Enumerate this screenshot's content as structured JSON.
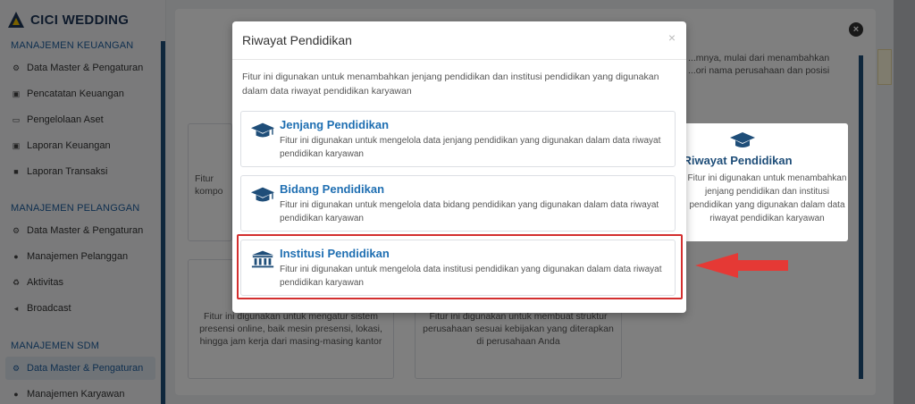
{
  "sidebar": {
    "logo_text": "CICI WEDDING",
    "sections": [
      {
        "label": "MANAJEMEN KEUANGAN"
      },
      {
        "label": "MANAJEMEN PELANGGAN"
      },
      {
        "label": "MANAJEMEN SDM"
      }
    ],
    "items": [
      {
        "label": "Data Master & Pengaturan",
        "icon": "cogs-icon"
      },
      {
        "label": "Pencatatan Keuangan",
        "icon": "money-icon"
      },
      {
        "label": "Pengelolaan Aset",
        "icon": "laptop-icon"
      },
      {
        "label": "Laporan Keuangan",
        "icon": "report-icon"
      },
      {
        "label": "Laporan Transaksi",
        "icon": "book-icon"
      },
      {
        "label": "Data Master & Pengaturan",
        "icon": "cogs-icon"
      },
      {
        "label": "Manajemen Pelanggan",
        "icon": "users-icon"
      },
      {
        "label": "Aktivitas",
        "icon": "recycle-icon"
      },
      {
        "label": "Broadcast",
        "icon": "megaphone-icon"
      },
      {
        "label": "Data Master & Pengaturan",
        "icon": "cogs-icon"
      },
      {
        "label": "Manajemen Karyawan",
        "icon": "users-icon"
      }
    ]
  },
  "background": {
    "card_presensi_desc": "Fitur ini digunakan untuk mengatur sistem presensi online, baik mesin presensi, lokasi, hingga jam kerja dari masing-masing kantor",
    "card_struktur_desc": "Fitur ini digunakan untuk membuat struktur perusahaan sesuai kebijakan yang diterapkan di perusahaan Anda",
    "card_riwayat_title": "Riwayat Pendidikan",
    "card_riwayat_desc": "Fitur ini digunakan untuk menambahkan jenjang pendidikan dan institusi pendidikan yang digunakan dalam data riwayat pendidikan karyawan",
    "top_right_snippet_1": "...mnya, mulai dari menambahkan",
    "top_right_snippet_2": "...ori nama perusahaan dan posisi",
    "left_snippet_1": "Fitur",
    "left_snippet_2": "kompo"
  },
  "modal": {
    "title": "Riwayat Pendidikan",
    "close_label": "×",
    "intro": "Fitur ini digunakan untuk menambahkan jenjang pendidikan dan institusi pendidikan yang digunakan dalam data riwayat pendidikan karyawan",
    "options": [
      {
        "title": "Jenjang Pendidikan",
        "desc": "Fitur ini digunakan untuk mengelola data jenjang pendidikan yang digunakan dalam data riwayat pendidikan karyawan",
        "icon": "graduation-cap-icon"
      },
      {
        "title": "Bidang Pendidikan",
        "desc": "Fitur ini digunakan untuk mengelola data bidang pendidikan yang digunakan dalam data riwayat pendidikan karyawan",
        "icon": "graduation-cap-icon"
      },
      {
        "title": "Institusi Pendidikan",
        "desc": "Fitur ini digunakan untuk mengelola data institusi pendidikan yang digunakan dalam data riwayat pendidikan karyawan",
        "icon": "university-icon"
      }
    ]
  },
  "colors": {
    "accent": "#1f6fb2",
    "highlight": "#d32f2f",
    "brand": "#1d3557"
  }
}
